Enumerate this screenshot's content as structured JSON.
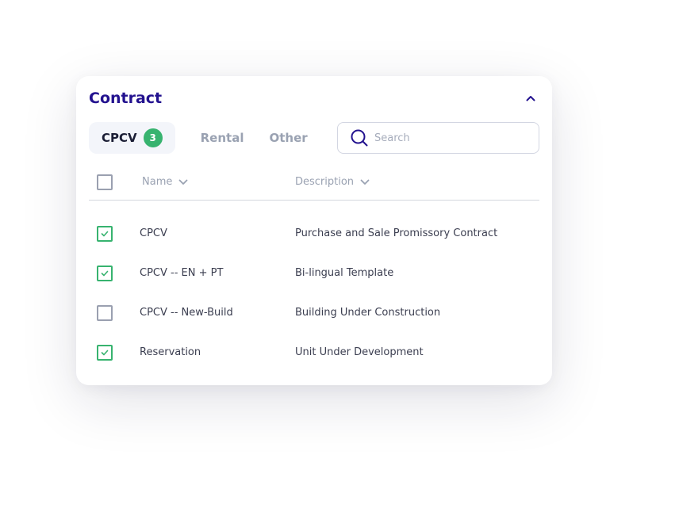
{
  "title": "Contract",
  "tabs": [
    {
      "label": "CPCV",
      "count": "3",
      "active": true
    },
    {
      "label": "Rental",
      "active": false
    },
    {
      "label": "Other",
      "active": false
    }
  ],
  "search": {
    "placeholder": "Search",
    "value": ""
  },
  "table": {
    "columns": [
      {
        "label": "Name",
        "icon": "chevron-down-icon"
      },
      {
        "label": "Description",
        "icon": "chevron-down-icon"
      }
    ],
    "select_all_checked": false,
    "rows": [
      {
        "name": "CPCV",
        "description": "Purchase and Sale Promissory Contract",
        "checked": true
      },
      {
        "name": "CPCV -- EN + PT",
        "description": "Bi-lingual Template",
        "checked": true
      },
      {
        "name": "CPCV -- New-Build",
        "description": "Building Under Construction",
        "checked": false
      },
      {
        "name": "Reservation",
        "description": "Unit Under Development",
        "checked": true
      }
    ]
  },
  "icons": {
    "collapse": "chevron-up-icon",
    "search": "search-icon",
    "check": "check-icon"
  },
  "colors": {
    "title": "#23128f",
    "accent_green": "#37b36f",
    "text_dark": "#1b1e35",
    "text_muted": "#9aa2b2",
    "active_tab_bg": "#f3f5fa"
  }
}
